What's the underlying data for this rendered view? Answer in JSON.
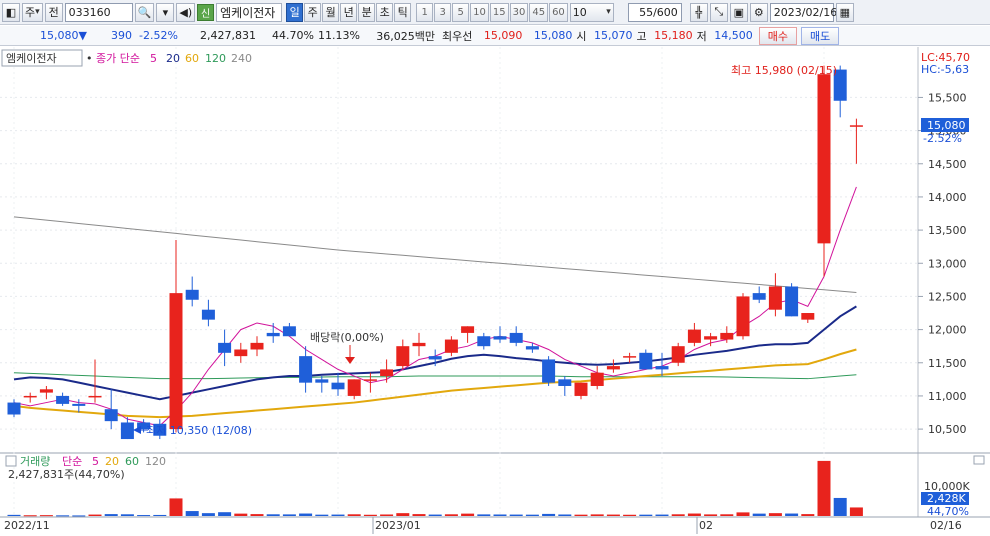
{
  "toolbar": {
    "market_label": "주",
    "prev_label": "전",
    "code": "033160",
    "badge": "신",
    "stock_name": "엠케이전자",
    "periods": [
      "일",
      "주",
      "월",
      "년",
      "분",
      "초",
      "틱"
    ],
    "active_period": "일",
    "intervals": [
      "1",
      "3",
      "5",
      "10",
      "15",
      "30",
      "45",
      "60"
    ],
    "count_select": "10",
    "bar_count": "55/600",
    "date": "2023/02/16"
  },
  "price_bar": {
    "current": "15,080",
    "arrow": "▼",
    "change": "390",
    "change_pct": "-2.52%",
    "volume": "2,427,831",
    "volume_ratio": "44.70%",
    "turnover_rate": "11.13%",
    "amount": "36,025백만",
    "best_bid_label": "최우선",
    "best_bid": "15,090",
    "best_ask": "15,080",
    "open_label": "시",
    "open": "15,070",
    "high_label": "고",
    "high": "15,180",
    "low_label": "저",
    "low": "14,500",
    "buy_label": "매수",
    "sell_label": "매도"
  },
  "price_legend": {
    "name": "엠케이전자",
    "ma_label": "종가 단순",
    "ma_periods": [
      "5",
      "20",
      "60",
      "120",
      "240"
    ]
  },
  "volume_legend": {
    "name": "거래량",
    "ma_label": "단순",
    "ma_periods": [
      "5",
      "20",
      "60",
      "120"
    ],
    "value_text": "2,427,831주(44,70%)"
  },
  "indicators": {
    "lc": "LC:45,70",
    "hc": "HC:-5,63"
  },
  "annotations": {
    "high": "최고 15,980 (02/15)",
    "low": "최저 10,350 (12/08)",
    "dividend": "배당락(0,00%)"
  },
  "current_tag": {
    "price": "15,080",
    "pct": "-2.52%"
  },
  "volume_axis": {
    "tick": "10,000K",
    "current": "2,428K",
    "pct": "44,70%"
  },
  "x_axis": {
    "labels": [
      "2022/11",
      "2023/01",
      "02"
    ],
    "end_label": "02/16"
  },
  "colors": {
    "up": "#e8231d",
    "down": "#1f5fd9",
    "ma5": "#d1139b",
    "ma20": "#1a2a8a",
    "ma60": "#e2a80d",
    "ma120": "#2f9a5a",
    "ma240": "#8a8a8a"
  },
  "chart_data": {
    "type": "candlestick",
    "y_ticks": [
      10500,
      11000,
      11500,
      12000,
      12500,
      13000,
      13500,
      14000,
      14500,
      15000,
      15500
    ],
    "ylim": [
      10200,
      16200
    ],
    "candles": [
      {
        "o": 10900,
        "h": 10950,
        "l": 10680,
        "c": 10720
      },
      {
        "o": 10980,
        "h": 11050,
        "l": 10900,
        "c": 11000
      },
      {
        "o": 11050,
        "h": 11150,
        "l": 10950,
        "c": 11100
      },
      {
        "o": 11000,
        "h": 11050,
        "l": 10850,
        "c": 10880
      },
      {
        "o": 10880,
        "h": 10950,
        "l": 10750,
        "c": 10850
      },
      {
        "o": 10980,
        "h": 11550,
        "l": 10900,
        "c": 11000
      },
      {
        "o": 10800,
        "h": 11100,
        "l": 10500,
        "c": 10620
      },
      {
        "o": 10600,
        "h": 10680,
        "l": 10350,
        "c": 10350
      },
      {
        "o": 10600,
        "h": 10650,
        "l": 10450,
        "c": 10500
      },
      {
        "o": 10580,
        "h": 10650,
        "l": 10350,
        "c": 10400
      },
      {
        "o": 10500,
        "h": 13350,
        "l": 10450,
        "c": 12550
      },
      {
        "o": 12600,
        "h": 12800,
        "l": 12350,
        "c": 12450
      },
      {
        "o": 12300,
        "h": 12450,
        "l": 12050,
        "c": 12150
      },
      {
        "o": 11800,
        "h": 12000,
        "l": 11450,
        "c": 11650
      },
      {
        "o": 11600,
        "h": 11800,
        "l": 11500,
        "c": 11700
      },
      {
        "o": 11700,
        "h": 11900,
        "l": 11600,
        "c": 11800
      },
      {
        "o": 11950,
        "h": 12100,
        "l": 11800,
        "c": 11900
      },
      {
        "o": 12050,
        "h": 12100,
        "l": 11900,
        "c": 11900
      },
      {
        "o": 11600,
        "h": 11750,
        "l": 11050,
        "c": 11200
      },
      {
        "o": 11250,
        "h": 11300,
        "l": 11050,
        "c": 11200
      },
      {
        "o": 11200,
        "h": 11350,
        "l": 11000,
        "c": 11100
      },
      {
        "o": 11000,
        "h": 11250,
        "l": 10950,
        "c": 11250
      },
      {
        "o": 11250,
        "h": 11350,
        "l": 11050,
        "c": 11250
      },
      {
        "o": 11300,
        "h": 11550,
        "l": 11200,
        "c": 11400
      },
      {
        "o": 11450,
        "h": 11850,
        "l": 11400,
        "c": 11750
      },
      {
        "o": 11750,
        "h": 11950,
        "l": 11600,
        "c": 11800
      },
      {
        "o": 11600,
        "h": 11700,
        "l": 11450,
        "c": 11550
      },
      {
        "o": 11650,
        "h": 11900,
        "l": 11600,
        "c": 11850
      },
      {
        "o": 11950,
        "h": 12050,
        "l": 11800,
        "c": 12050
      },
      {
        "o": 11900,
        "h": 11950,
        "l": 11700,
        "c": 11750
      },
      {
        "o": 11900,
        "h": 12050,
        "l": 11800,
        "c": 11850
      },
      {
        "o": 11950,
        "h": 12050,
        "l": 11750,
        "c": 11800
      },
      {
        "o": 11750,
        "h": 11800,
        "l": 11650,
        "c": 11700
      },
      {
        "o": 11550,
        "h": 11600,
        "l": 11150,
        "c": 11200
      },
      {
        "o": 11250,
        "h": 11300,
        "l": 11000,
        "c": 11150
      },
      {
        "o": 11000,
        "h": 11200,
        "l": 10950,
        "c": 11200
      },
      {
        "o": 11150,
        "h": 11450,
        "l": 11100,
        "c": 11350
      },
      {
        "o": 11400,
        "h": 11550,
        "l": 11350,
        "c": 11450
      },
      {
        "o": 11600,
        "h": 11650,
        "l": 11500,
        "c": 11600
      },
      {
        "o": 11650,
        "h": 11700,
        "l": 11450,
        "c": 11400
      },
      {
        "o": 11450,
        "h": 11650,
        "l": 11300,
        "c": 11400
      },
      {
        "o": 11500,
        "h": 11800,
        "l": 11450,
        "c": 11750
      },
      {
        "o": 11800,
        "h": 12100,
        "l": 11750,
        "c": 12000
      },
      {
        "o": 11850,
        "h": 11950,
        "l": 11750,
        "c": 11900
      },
      {
        "o": 11850,
        "h": 12050,
        "l": 11800,
        "c": 11950
      },
      {
        "o": 11900,
        "h": 12550,
        "l": 11850,
        "c": 12500
      },
      {
        "o": 12550,
        "h": 12650,
        "l": 12400,
        "c": 12450
      },
      {
        "o": 12300,
        "h": 12850,
        "l": 12200,
        "c": 12650
      },
      {
        "o": 12650,
        "h": 12700,
        "l": 12200,
        "c": 12200
      },
      {
        "o": 12150,
        "h": 12250,
        "l": 12100,
        "c": 12250
      },
      {
        "o": 13300,
        "h": 15980,
        "l": 12800,
        "c": 15850
      },
      {
        "o": 15920,
        "h": 15980,
        "l": 15200,
        "c": 15450
      },
      {
        "o": 15070,
        "h": 15180,
        "l": 14500,
        "c": 15080
      }
    ],
    "ma5": [
      10900,
      10850,
      10900,
      10950,
      10900,
      10880,
      10800,
      10650,
      10600,
      10550,
      10780,
      11050,
      11400,
      11700,
      12000,
      12100,
      12050,
      11900,
      11700,
      11550,
      11400,
      11300,
      11200,
      11250,
      11400,
      11550,
      11600,
      11700,
      11750,
      11850,
      11900,
      11850,
      11800,
      11700,
      11550,
      11450,
      11350,
      11300,
      11350,
      11400,
      11450,
      11550,
      11700,
      11800,
      11850,
      12050,
      12200,
      12400,
      12450,
      12350,
      12800,
      13500,
      14150
    ],
    "ma20": [
      11250,
      11280,
      11270,
      11250,
      11200,
      11150,
      11100,
      11050,
      11000,
      10950,
      11000,
      11050,
      11100,
      11150,
      11200,
      11250,
      11280,
      11300,
      11300,
      11320,
      11330,
      11340,
      11350,
      11360,
      11400,
      11450,
      11500,
      11560,
      11600,
      11620,
      11600,
      11570,
      11550,
      11520,
      11500,
      11480,
      11470,
      11480,
      11500,
      11520,
      11550,
      11580,
      11620,
      11650,
      11680,
      11720,
      11760,
      11780,
      11780,
      11800,
      12000,
      12200,
      12350
    ],
    "ma60": [
      10850,
      10820,
      10800,
      10780,
      10760,
      10740,
      10720,
      10700,
      10690,
      10680,
      10690,
      10700,
      10720,
      10740,
      10760,
      10780,
      10800,
      10820,
      10840,
      10860,
      10880,
      10900,
      10930,
      10960,
      10990,
      11020,
      11050,
      11080,
      11100,
      11120,
      11140,
      11160,
      11180,
      11200,
      11210,
      11220,
      11240,
      11260,
      11280,
      11300,
      11320,
      11340,
      11360,
      11380,
      11400,
      11420,
      11440,
      11460,
      11470,
      11480,
      11550,
      11630,
      11700
    ],
    "ma120": [
      11350,
      11340,
      11330,
      11320,
      11310,
      11300,
      11290,
      11280,
      11270,
      11260,
      11260,
      11260,
      11260,
      11265,
      11270,
      11275,
      11280,
      11280,
      11280,
      11285,
      11290,
      11290,
      11290,
      11290,
      11295,
      11300,
      11300,
      11300,
      11300,
      11300,
      11300,
      11300,
      11300,
      11300,
      11295,
      11290,
      11290,
      11290,
      11290,
      11290,
      11290,
      11290,
      11290,
      11290,
      11285,
      11280,
      11275,
      11270,
      11265,
      11260,
      11280,
      11300,
      11320
    ],
    "ma240": [
      13700,
      13675,
      13650,
      13625,
      13600,
      13575,
      13550,
      13525,
      13500,
      13475,
      13450,
      13425,
      13400,
      13375,
      13350,
      13325,
      13300,
      13275,
      13250,
      13225,
      13200,
      13180,
      13160,
      13140,
      13120,
      13100,
      13080,
      13060,
      13040,
      13020,
      13000,
      12980,
      12960,
      12940,
      12920,
      12900,
      12880,
      12860,
      12840,
      12820,
      12800,
      12780,
      12760,
      12740,
      12720,
      12700,
      12680,
      12660,
      12640,
      12620,
      12600,
      12580,
      12560
    ],
    "volume": [
      120,
      80,
      90,
      70,
      60,
      150,
      200,
      180,
      100,
      110,
      1850,
      520,
      300,
      400,
      250,
      200,
      180,
      170,
      260,
      140,
      150,
      180,
      130,
      160,
      300,
      200,
      150,
      180,
      250,
      170,
      160,
      150,
      140,
      220,
      160,
      140,
      170,
      150,
      130,
      140,
      150,
      180,
      260,
      170,
      180,
      380,
      250,
      300,
      260,
      200,
      5800,
      1900,
      900
    ],
    "volume_ylim": [
      0,
      6000
    ]
  }
}
